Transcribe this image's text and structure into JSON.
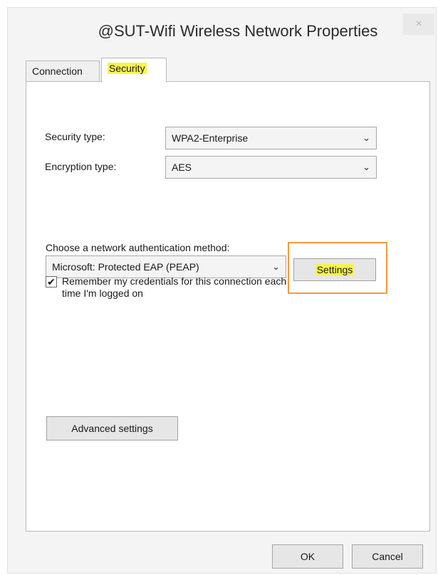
{
  "window": {
    "title": "@SUT-Wifi Wireless Network Properties",
    "close_glyph": "×"
  },
  "tabs": [
    {
      "label": "Connection"
    },
    {
      "label": "Security"
    }
  ],
  "security": {
    "security_type_label": "Security type:",
    "security_type_value": "WPA2-Enterprise",
    "encryption_type_label": "Encryption type:",
    "encryption_type_value": "AES",
    "auth_method_label": "Choose a network authentication method:",
    "auth_method_value": "Microsoft: Protected EAP (PEAP)",
    "settings_button": "Settings",
    "remember_checked": true,
    "remember_label_line1": "Remember my credentials for this connection each",
    "remember_label_line2": "time I'm logged on",
    "advanced_button": "Advanced settings",
    "chevron_glyph": "⌄",
    "check_glyph": "✔"
  },
  "footer": {
    "ok_button": "OK",
    "cancel_button": "Cancel"
  },
  "colors": {
    "highlight": "#f7f54a",
    "annotation_box": "#f29a3e"
  }
}
